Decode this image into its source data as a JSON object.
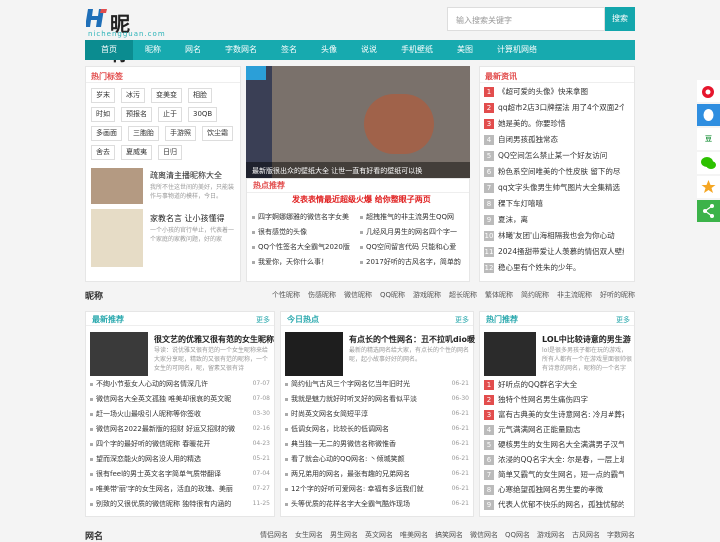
{
  "site": {
    "name": "昵称馆",
    "domain": "nichengguan.com"
  },
  "search": {
    "placeholder": "输入搜索关键字",
    "button": "搜索"
  },
  "nav": [
    "首页",
    "昵称",
    "网名",
    "字数网名",
    "签名",
    "头像",
    "说说",
    "手机壁纸",
    "美图",
    "计算机网络"
  ],
  "tags": {
    "title": "热门标签",
    "items": [
      "岁末",
      "冰污",
      "变美变",
      "相脸",
      "时如",
      "预报名",
      "止于",
      "30QB",
      "多画面",
      "三胞胎",
      "手游照",
      "饮尘霜",
      "舍去",
      "夏威夷",
      "日归"
    ]
  },
  "left_cards": [
    {
      "title": "疏离清主播昵称大全",
      "desc": "我所不住这世间的美好，只能装作与事物道的模样，今日。"
    },
    {
      "title": "家教名言 让小孩懂得",
      "desc": "一个小孩的官行举止，代表着一个家庭的家教问题，好的家"
    }
  ],
  "slider": {
    "caption": "最新版很出众的壁纸大全 让世一直有好看的壁纸可以换"
  },
  "hot": {
    "title": "热点推荐",
    "headline": "发表表情最近超级火爆 给你整眼子两页",
    "items": [
      "四字婀娜娜雅的微信名字女美",
      "超拽推气的非主流男生QQ网",
      "很有感觉的头像",
      "几经风月男生的网名四个字一",
      "QQ个性签名大全霸气2020版",
      "QQ空间留言代码 只能和心爱",
      "我爱你，天你什么事！",
      "2017好听的古风名字，简单韵"
    ]
  },
  "news": {
    "title": "最新资讯",
    "items": [
      "《超可爱的头像》快来拿图",
      "qq超市2店3口牌摆法 用了4个双面2个",
      "她是美的。你要珍惜",
      "自闭男孩孤独常态",
      "QQ空间怎么禁止某一个好友访问",
      "粉色系空间唯美的个性皮肤 留下的尽",
      "qq文字头像男生帅气图片大全集精选",
      "稞下车灯嘻嘻",
      "夏沫，离",
      "林曦'友团'山海相隔我也会为你心动",
      "2024搔甜带爱让人羡慕的情侣双人壁纸",
      "稳心里有个姓朱的少年。"
    ]
  },
  "section": {
    "title": "昵称",
    "links": [
      "个性昵称",
      "伤感昵称",
      "微信昵称",
      "QQ昵称",
      "游戏昵称",
      "超长昵称",
      "繁体昵称",
      "简约昵称",
      "非主流昵称",
      "好听的昵称"
    ]
  },
  "col1": {
    "title": "最新推荐",
    "more": "更多",
    "feature": {
      "title": "很文艺的优雅又很有范的女生昵称",
      "desc": "导读：说优雅又很有范的一个女生昵称来给大家分享呢，精致的又很有范的昵称，一个女生的可网名，昵，留素又很有诗"
    },
    "items": [
      [
        "不绚小节惹女人心动的网名情深几许",
        "07-07"
      ],
      [
        "微信网名大全英文孤独 唯美却很哀的英文昵",
        "07-08"
      ],
      [
        "赶一场火山最吸引人昵称等你签收",
        "03-30"
      ],
      [
        "微信网名2022最新版的招财 好运又招财的微",
        "02-16"
      ],
      [
        "四个字的最好听的微信昵称 春暖花开",
        "04-23"
      ],
      [
        "望而深恋能火的网名没人用的精选",
        "05-21"
      ],
      [
        "很有feel的男士英文名字简单气质带翻译",
        "07-04"
      ],
      [
        "唯美带'丽'字的女生网名，活血的玫瑰、美丽",
        "07-27"
      ],
      [
        "别致的又很优质的微信昵称 独特很有内涵的",
        "11-25"
      ]
    ]
  },
  "col2": {
    "title": "今日热点",
    "more": "更多",
    "feature": {
      "title": "有点长的个性网名：丑不拉叽dio暖",
      "desc": "最新的精选网名给大家，有点长的个性的网名呢，起小故事好好的网名。"
    },
    "items": [
      [
        "简约仙气古风三个字网名忆当年旧时光",
        "06-21"
      ],
      [
        "我就是魅力就好时听叉好的网名看似平淡",
        "06-30"
      ],
      [
        "时尚英文网名女简短平淳",
        "06-21"
      ],
      [
        "低调女网名，比较长的低调网名",
        "06-21"
      ],
      [
        "典当独一无二的男微信名称微惟香",
        "06-21"
      ],
      [
        "看了就会心动的QQ网名: 丶倾城笑颜",
        "06-21"
      ],
      [
        "两兄弟用的网名，最张有趣的兄弟网名",
        "06-21"
      ],
      [
        "12个字的好听可爱网名: 幸福有多远我们就",
        "06-21"
      ],
      [
        "头等优质的花样名字大全霸气酷炸现场",
        "06-21"
      ]
    ]
  },
  "col3": {
    "title": "热门推荐",
    "more": "更多",
    "feature": {
      "title": "LOL中比较诗意的男生游",
      "desc": "lol是很多男孩子都在玩的游戏，所有人都有一个在游戏里面很帅很有诗意的网名，昵称的一个名字"
    },
    "items": [
      "好听点的QQ群名字大全",
      "独特个性网名男生痛伤四字",
      "富有古典美的女生诗意网名: 冷月#葬花人",
      "元气满满网名正能量励志",
      "硬核男生的女生网名大全满满男子汉气息",
      "浓浸的QQ名字大全: 尔是春，一层上堤无",
      "简单又霸气的女生网名，短一点的霸气网名",
      "心寒绝望孤独网名男生要的孝微",
      "代表人优郁不快乐的网名，孤独忧郁的qq"
    ]
  },
  "bottom": {
    "title": "网名",
    "links": [
      "情侣网名",
      "女生网名",
      "男生网名",
      "英文网名",
      "唯美网名",
      "搞笑网名",
      "微信网名",
      "QQ网名",
      "游戏网名",
      "古风网名",
      "字数网名"
    ]
  }
}
